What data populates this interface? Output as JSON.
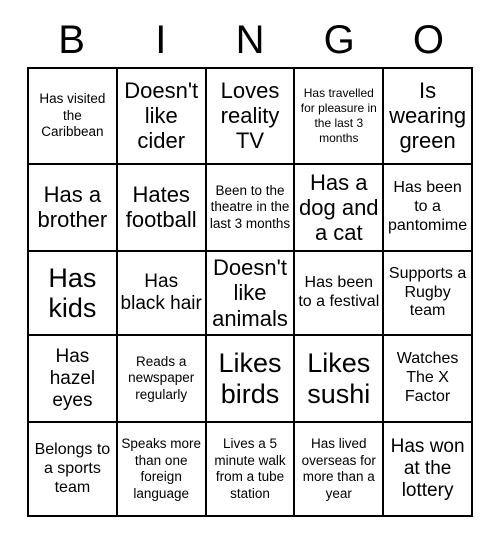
{
  "header": {
    "letters": [
      "B",
      "I",
      "N",
      "G",
      "O"
    ]
  },
  "grid": {
    "columns": 5,
    "rows": 5,
    "cells": [
      [
        {
          "text": "Has visited the Caribbean",
          "size": "xs"
        },
        {
          "text": "Doesn't like cider",
          "size": "lg"
        },
        {
          "text": "Loves reality TV",
          "size": "lg"
        },
        {
          "text": "Has travelled for pleasure in the last 3 months",
          "size": "xxs"
        },
        {
          "text": "Is wearing green",
          "size": "lg"
        }
      ],
      [
        {
          "text": "Has a brother",
          "size": "lg"
        },
        {
          "text": "Hates football",
          "size": "lg"
        },
        {
          "text": "Been to the theatre in the last 3 months",
          "size": "xs"
        },
        {
          "text": "Has a dog and a cat",
          "size": "lg"
        },
        {
          "text": "Has been to a pantomime",
          "size": "sm"
        }
      ],
      [
        {
          "text": "Has kids",
          "size": "xl"
        },
        {
          "text": "Has black hair",
          "size": "md"
        },
        {
          "text": "Doesn't like animals",
          "size": "lg"
        },
        {
          "text": "Has been to a festival",
          "size": "sm"
        },
        {
          "text": "Supports a Rugby team",
          "size": "sm"
        }
      ],
      [
        {
          "text": "Has hazel eyes",
          "size": "md"
        },
        {
          "text": "Reads a newspaper regularly",
          "size": "xs"
        },
        {
          "text": "Likes birds",
          "size": "xl"
        },
        {
          "text": "Likes sushi",
          "size": "xl"
        },
        {
          "text": "Watches The X Factor",
          "size": "sm"
        }
      ],
      [
        {
          "text": "Belongs to a sports team",
          "size": "sm"
        },
        {
          "text": "Speaks more than one foreign language",
          "size": "xs"
        },
        {
          "text": "Lives a 5 minute walk from a tube station",
          "size": "xs"
        },
        {
          "text": "Has lived overseas for more than a year",
          "size": "xs"
        },
        {
          "text": "Has won at the lottery",
          "size": "md"
        }
      ]
    ]
  },
  "colors": {
    "background": "#ffffff",
    "text": "#000000",
    "border": "#000000"
  }
}
